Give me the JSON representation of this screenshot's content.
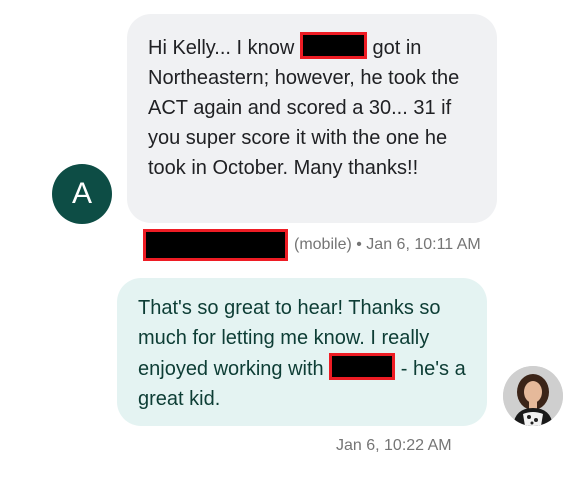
{
  "incoming": {
    "avatar_letter": "A",
    "text_1": "Hi Kelly... I know ",
    "text_2": " got in Northeastern; however, he took the ACT again and scored a 30... 31 if you super score it with the one he took in October.  Many thanks!!",
    "meta_device": "(mobile)",
    "meta_separator": " • ",
    "meta_time": "Jan 6, 10:11 AM"
  },
  "outgoing": {
    "text_1": "That's so great to hear! Thanks so much for letting me know. I really enjoyed working with ",
    "text_2": " - he's a great kid.",
    "time": "Jan 6, 10:22 AM"
  },
  "colors": {
    "incoming_bubble": "#f0f1f3",
    "outgoing_bubble": "#e4f3f2",
    "avatar_bg": "#0d4d45",
    "redaction_fill": "#000000",
    "redaction_border": "#ee1c24"
  }
}
